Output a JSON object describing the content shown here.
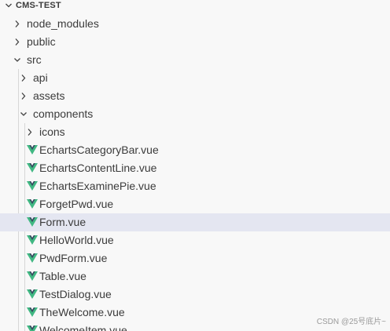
{
  "explorer": {
    "title": "CMS-TEST",
    "items": [
      {
        "label": "node_modules",
        "type": "folder",
        "expanded": false,
        "icon": "chevron-right-icon"
      },
      {
        "label": "public",
        "type": "folder",
        "expanded": false,
        "icon": "chevron-right-icon"
      },
      {
        "label": "src",
        "type": "folder",
        "expanded": true,
        "icon": "chevron-down-icon"
      },
      {
        "label": "api",
        "type": "folder",
        "expanded": false,
        "icon": "chevron-right-icon"
      },
      {
        "label": "assets",
        "type": "folder",
        "expanded": false,
        "icon": "chevron-right-icon"
      },
      {
        "label": "components",
        "type": "folder",
        "expanded": true,
        "icon": "chevron-down-icon"
      },
      {
        "label": "icons",
        "type": "folder",
        "expanded": false,
        "icon": "chevron-right-icon"
      },
      {
        "label": "EchartsCategoryBar.vue",
        "type": "file",
        "icon": "vue-file-icon"
      },
      {
        "label": "EchartsContentLine.vue",
        "type": "file",
        "icon": "vue-file-icon"
      },
      {
        "label": "EchartsExaminePie.vue",
        "type": "file",
        "icon": "vue-file-icon"
      },
      {
        "label": "ForgetPwd.vue",
        "type": "file",
        "icon": "vue-file-icon"
      },
      {
        "label": "Form.vue",
        "type": "file",
        "icon": "vue-file-icon",
        "selected": true
      },
      {
        "label": "HelloWorld.vue",
        "type": "file",
        "icon": "vue-file-icon"
      },
      {
        "label": "PwdForm.vue",
        "type": "file",
        "icon": "vue-file-icon"
      },
      {
        "label": "Table.vue",
        "type": "file",
        "icon": "vue-file-icon"
      },
      {
        "label": "TestDialog.vue",
        "type": "file",
        "icon": "vue-file-icon"
      },
      {
        "label": "TheWelcome.vue",
        "type": "file",
        "icon": "vue-file-icon"
      },
      {
        "label": "WelcomeItem.vue",
        "type": "file",
        "icon": "vue-file-icon"
      }
    ]
  },
  "watermark": "CSDN @25号底片~",
  "colors": {
    "background": "#f8f8f8",
    "selected_row": "#e4e6f1",
    "text": "#3b3b3b",
    "vue_green": "#41b883",
    "vue_dark": "#35495e"
  }
}
